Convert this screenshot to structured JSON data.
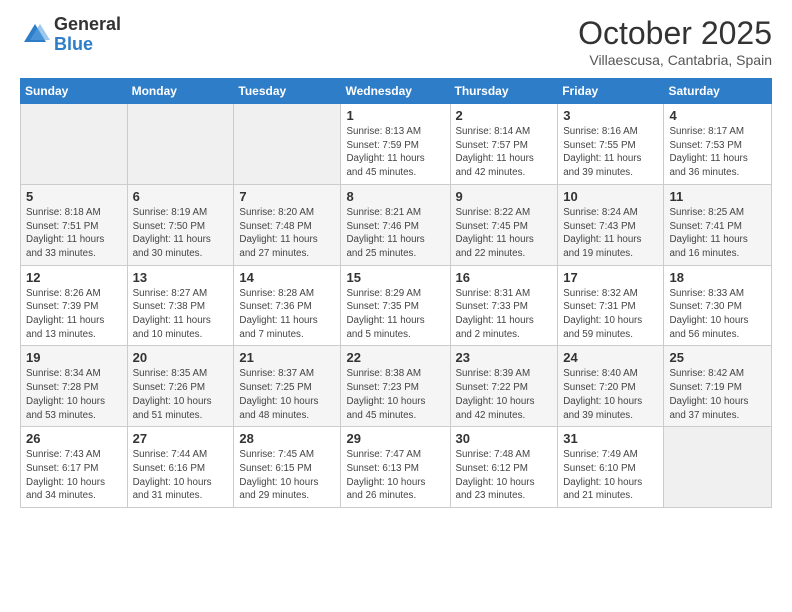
{
  "logo": {
    "general": "General",
    "blue": "Blue"
  },
  "header": {
    "month": "October 2025",
    "location": "Villaescusa, Cantabria, Spain"
  },
  "columns": [
    "Sunday",
    "Monday",
    "Tuesday",
    "Wednesday",
    "Thursday",
    "Friday",
    "Saturday"
  ],
  "weeks": [
    [
      {
        "day": "",
        "info": ""
      },
      {
        "day": "",
        "info": ""
      },
      {
        "day": "",
        "info": ""
      },
      {
        "day": "1",
        "info": "Sunrise: 8:13 AM\nSunset: 7:59 PM\nDaylight: 11 hours\nand 45 minutes."
      },
      {
        "day": "2",
        "info": "Sunrise: 8:14 AM\nSunset: 7:57 PM\nDaylight: 11 hours\nand 42 minutes."
      },
      {
        "day": "3",
        "info": "Sunrise: 8:16 AM\nSunset: 7:55 PM\nDaylight: 11 hours\nand 39 minutes."
      },
      {
        "day": "4",
        "info": "Sunrise: 8:17 AM\nSunset: 7:53 PM\nDaylight: 11 hours\nand 36 minutes."
      }
    ],
    [
      {
        "day": "5",
        "info": "Sunrise: 8:18 AM\nSunset: 7:51 PM\nDaylight: 11 hours\nand 33 minutes."
      },
      {
        "day": "6",
        "info": "Sunrise: 8:19 AM\nSunset: 7:50 PM\nDaylight: 11 hours\nand 30 minutes."
      },
      {
        "day": "7",
        "info": "Sunrise: 8:20 AM\nSunset: 7:48 PM\nDaylight: 11 hours\nand 27 minutes."
      },
      {
        "day": "8",
        "info": "Sunrise: 8:21 AM\nSunset: 7:46 PM\nDaylight: 11 hours\nand 25 minutes."
      },
      {
        "day": "9",
        "info": "Sunrise: 8:22 AM\nSunset: 7:45 PM\nDaylight: 11 hours\nand 22 minutes."
      },
      {
        "day": "10",
        "info": "Sunrise: 8:24 AM\nSunset: 7:43 PM\nDaylight: 11 hours\nand 19 minutes."
      },
      {
        "day": "11",
        "info": "Sunrise: 8:25 AM\nSunset: 7:41 PM\nDaylight: 11 hours\nand 16 minutes."
      }
    ],
    [
      {
        "day": "12",
        "info": "Sunrise: 8:26 AM\nSunset: 7:39 PM\nDaylight: 11 hours\nand 13 minutes."
      },
      {
        "day": "13",
        "info": "Sunrise: 8:27 AM\nSunset: 7:38 PM\nDaylight: 11 hours\nand 10 minutes."
      },
      {
        "day": "14",
        "info": "Sunrise: 8:28 AM\nSunset: 7:36 PM\nDaylight: 11 hours\nand 7 minutes."
      },
      {
        "day": "15",
        "info": "Sunrise: 8:29 AM\nSunset: 7:35 PM\nDaylight: 11 hours\nand 5 minutes."
      },
      {
        "day": "16",
        "info": "Sunrise: 8:31 AM\nSunset: 7:33 PM\nDaylight: 11 hours\nand 2 minutes."
      },
      {
        "day": "17",
        "info": "Sunrise: 8:32 AM\nSunset: 7:31 PM\nDaylight: 10 hours\nand 59 minutes."
      },
      {
        "day": "18",
        "info": "Sunrise: 8:33 AM\nSunset: 7:30 PM\nDaylight: 10 hours\nand 56 minutes."
      }
    ],
    [
      {
        "day": "19",
        "info": "Sunrise: 8:34 AM\nSunset: 7:28 PM\nDaylight: 10 hours\nand 53 minutes."
      },
      {
        "day": "20",
        "info": "Sunrise: 8:35 AM\nSunset: 7:26 PM\nDaylight: 10 hours\nand 51 minutes."
      },
      {
        "day": "21",
        "info": "Sunrise: 8:37 AM\nSunset: 7:25 PM\nDaylight: 10 hours\nand 48 minutes."
      },
      {
        "day": "22",
        "info": "Sunrise: 8:38 AM\nSunset: 7:23 PM\nDaylight: 10 hours\nand 45 minutes."
      },
      {
        "day": "23",
        "info": "Sunrise: 8:39 AM\nSunset: 7:22 PM\nDaylight: 10 hours\nand 42 minutes."
      },
      {
        "day": "24",
        "info": "Sunrise: 8:40 AM\nSunset: 7:20 PM\nDaylight: 10 hours\nand 39 minutes."
      },
      {
        "day": "25",
        "info": "Sunrise: 8:42 AM\nSunset: 7:19 PM\nDaylight: 10 hours\nand 37 minutes."
      }
    ],
    [
      {
        "day": "26",
        "info": "Sunrise: 7:43 AM\nSunset: 6:17 PM\nDaylight: 10 hours\nand 34 minutes."
      },
      {
        "day": "27",
        "info": "Sunrise: 7:44 AM\nSunset: 6:16 PM\nDaylight: 10 hours\nand 31 minutes."
      },
      {
        "day": "28",
        "info": "Sunrise: 7:45 AM\nSunset: 6:15 PM\nDaylight: 10 hours\nand 29 minutes."
      },
      {
        "day": "29",
        "info": "Sunrise: 7:47 AM\nSunset: 6:13 PM\nDaylight: 10 hours\nand 26 minutes."
      },
      {
        "day": "30",
        "info": "Sunrise: 7:48 AM\nSunset: 6:12 PM\nDaylight: 10 hours\nand 23 minutes."
      },
      {
        "day": "31",
        "info": "Sunrise: 7:49 AM\nSunset: 6:10 PM\nDaylight: 10 hours\nand 21 minutes."
      },
      {
        "day": "",
        "info": ""
      }
    ]
  ]
}
